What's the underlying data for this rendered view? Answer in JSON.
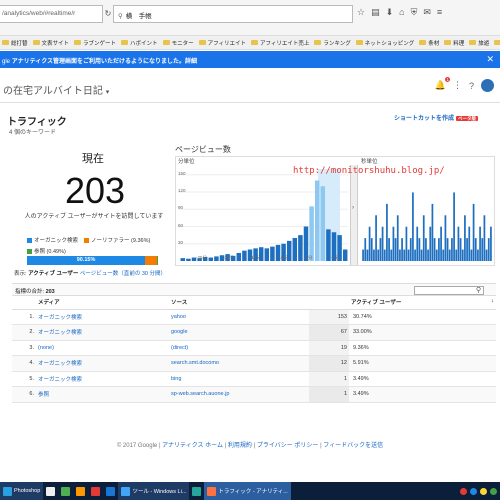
{
  "browser": {
    "url": "/analytics/web/#realtime/r",
    "search_text": "横　手帳",
    "chrome_icons": [
      "star-icon",
      "clipboard-icon",
      "download-icon",
      "home-icon",
      "shield-icon",
      "chat-icon",
      "menu-icon"
    ]
  },
  "bookmarks": [
    {
      "label": "総打替"
    },
    {
      "label": "文表サイト"
    },
    {
      "label": "ラブンゲート"
    },
    {
      "label": "ハボイント"
    },
    {
      "label": "モニター"
    },
    {
      "label": "アフィリエイト"
    },
    {
      "label": "アフィリエイト売上"
    },
    {
      "label": "ランキング"
    },
    {
      "label": "ネットショッピング"
    },
    {
      "label": "条材"
    },
    {
      "label": "料理"
    },
    {
      "label": "旅遊"
    },
    {
      "label": "保険"
    }
  ],
  "notice": {
    "prefix": "gle",
    "text": "アナリティクス管理画面をご利用いただけるようになりました。詳細",
    "close": "✕"
  },
  "header": {
    "property_name": "の在宅アルバイト日記",
    "notification_count": "1"
  },
  "report": {
    "title": "トラフィック",
    "subtitle": "4 個のキーワード",
    "shortcut": "ショートカットを作成",
    "beta": "ベータ版"
  },
  "summary": {
    "now_label": "現在",
    "active_users": "203",
    "description": "人のアクティブ ユーザーがサイトを訪問しています",
    "legend": [
      {
        "label": "オーガニック検索",
        "color": "#1e88e5"
      },
      {
        "label": "ノーリファラー (9.36%)",
        "color": "#f57c00"
      },
      {
        "label": "参照 (0.49%)",
        "color": "#43a047"
      }
    ],
    "bar_label": "90.15%",
    "bar_fractions": [
      0.9015,
      0.0936,
      0.0049
    ]
  },
  "tabs": {
    "label": "表示:",
    "active": "アクティブ ユーザー",
    "other": "ページビュー数（直前の 30 分間）"
  },
  "chart": {
    "title": "ページビュー数",
    "left_label": "分単位",
    "right_label": "秒単位",
    "watermark": "http://monitorshuhu.blog.jp/",
    "left_yticks": [
      "150",
      "120",
      "90",
      "60",
      "30"
    ],
    "left_xticks": [
      "-25分",
      "-20分",
      "-15分",
      "-10分",
      "-5分",
      "-1分"
    ],
    "collapse": "›"
  },
  "chart_data": [
    {
      "type": "bar",
      "title": "分単位",
      "x": [
        -30,
        -29,
        -28,
        -27,
        -26,
        -25,
        -24,
        -23,
        -22,
        -21,
        -20,
        -19,
        -18,
        -17,
        -16,
        -15,
        -14,
        -13,
        -12,
        -11,
        -10,
        -9,
        -8,
        -7,
        -6,
        -5,
        -4,
        -3,
        -2,
        -1
      ],
      "values": [
        5,
        4,
        6,
        5,
        7,
        6,
        8,
        10,
        12,
        9,
        14,
        18,
        20,
        22,
        24,
        22,
        25,
        28,
        30,
        35,
        40,
        45,
        60,
        95,
        140,
        130,
        55,
        50,
        45,
        20
      ],
      "ylim": [
        0,
        160
      ],
      "yticks": [
        30,
        60,
        90,
        120,
        150
      ]
    },
    {
      "type": "bar",
      "title": "秒単位",
      "x": [
        -60,
        -59,
        -58,
        -57,
        -56,
        -55,
        -54,
        -53,
        -52,
        -51,
        -50,
        -49,
        -48,
        -47,
        -46,
        -45,
        -44,
        -43,
        -42,
        -41,
        -40,
        -39,
        -38,
        -37,
        -36,
        -35,
        -34,
        -33,
        -32,
        -31,
        -30,
        -29,
        -28,
        -27,
        -26,
        -25,
        -24,
        -23,
        -22,
        -21,
        -20,
        -19,
        -18,
        -17,
        -16,
        -15,
        -14,
        -13,
        -12,
        -11,
        -10,
        -9,
        -8,
        -7,
        -6,
        -5,
        -4,
        -3,
        -2,
        -1
      ],
      "values": [
        1,
        2,
        1,
        3,
        2,
        1,
        4,
        1,
        2,
        3,
        1,
        5,
        2,
        1,
        3,
        2,
        4,
        1,
        2,
        1,
        3,
        1,
        2,
        6,
        1,
        3,
        2,
        1,
        4,
        2,
        1,
        3,
        5,
        2,
        1,
        2,
        3,
        1,
        4,
        2,
        1,
        2,
        6,
        1,
        3,
        2,
        1,
        4,
        2,
        3,
        1,
        5,
        2,
        1,
        3,
        2,
        4,
        1,
        2,
        3
      ],
      "ylim": [
        0,
        7
      ]
    }
  ],
  "table": {
    "total_label": "指標の合計:",
    "total_value": "203",
    "headers": {
      "media": "メディア",
      "source": "ソース",
      "active_users": "アクティブ ユーザー",
      "sort": "↓"
    },
    "rows": [
      {
        "rank": "1.",
        "media": "オーガニック検索",
        "source": "yahoo",
        "count": "153",
        "pct": "30.74%"
      },
      {
        "rank": "2.",
        "media": "オーガニック検索",
        "source": "google",
        "count": "67",
        "pct": "33.00%"
      },
      {
        "rank": "3.",
        "media": "(none)",
        "source": "(direct)",
        "count": "19",
        "pct": "9.36%"
      },
      {
        "rank": "4.",
        "media": "オーガニック検索",
        "source": "search.smt.docomo",
        "count": "12",
        "pct": "5.91%"
      },
      {
        "rank": "5.",
        "media": "オーガニック検索",
        "source": "bing",
        "count": "1",
        "pct": "3.49%"
      },
      {
        "rank": "6.",
        "media": "参照",
        "source": "sp-web.search.auone.jp",
        "count": "1",
        "pct": "3.49%"
      }
    ]
  },
  "footer": {
    "copyright": "© 2017 Google",
    "links": [
      "アナリティクス ホーム",
      "利用規約",
      "プライバシー ポリシー",
      "フィードバックを送信"
    ],
    "sep": " | "
  },
  "taskbar": {
    "items": [
      {
        "label": "Photoshop",
        "color": "#2aa0e0"
      },
      {
        "label": "",
        "color": "#eee"
      },
      {
        "label": "",
        "color": "#4caf50"
      },
      {
        "label": "",
        "color": "#ff9800"
      },
      {
        "label": "",
        "color": "#e53935"
      },
      {
        "label": "",
        "color": "#1976d2"
      },
      {
        "label": "ツール - Windows Li...",
        "color": "#42a5f5"
      },
      {
        "label": "",
        "color": "#26a69a"
      },
      {
        "label": "トラフィック - アナリティ...",
        "color": "#ff7043"
      }
    ]
  }
}
